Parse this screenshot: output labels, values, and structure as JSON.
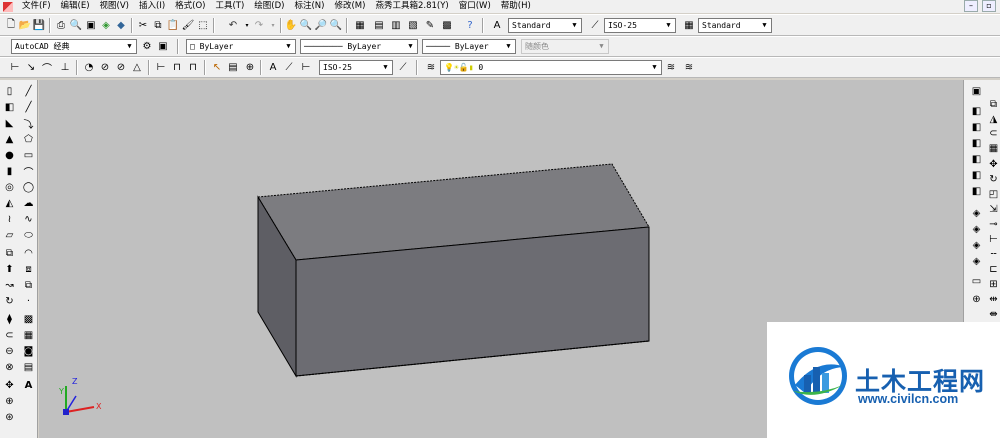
{
  "menubar": {
    "items": [
      "文件(F)",
      "编辑(E)",
      "视图(V)",
      "插入(I)",
      "格式(O)",
      "工具(T)",
      "绘图(D)",
      "标注(N)",
      "修改(M)",
      "燕秀工具箱2.81(Y)",
      "窗口(W)",
      "帮助(H)"
    ]
  },
  "toolbar1": {
    "text_style": "Standard",
    "dim_style": "ISO-25",
    "table_style": "Standard"
  },
  "toolbar2": {
    "workspace": "AutoCAD 经典",
    "color": "ByLayer",
    "linetype": "ByLayer",
    "lineweight": "ByLayer",
    "plotstyle": "随颜色"
  },
  "toolbar3": {
    "dim_style": "ISO-25",
    "layer": "0"
  },
  "ucs": {
    "x_label": "X",
    "y_label": "Y",
    "z_label": "Z"
  },
  "watermark": {
    "title": "土木工程网",
    "url": "www.civilcn.com"
  },
  "colors": {
    "box_front": "#6c6c72",
    "box_top": "#7c7c80",
    "box_side": "#5e5e64",
    "canvas_bg": "#c0c0c0",
    "watermark_blue": "#1760b0"
  }
}
